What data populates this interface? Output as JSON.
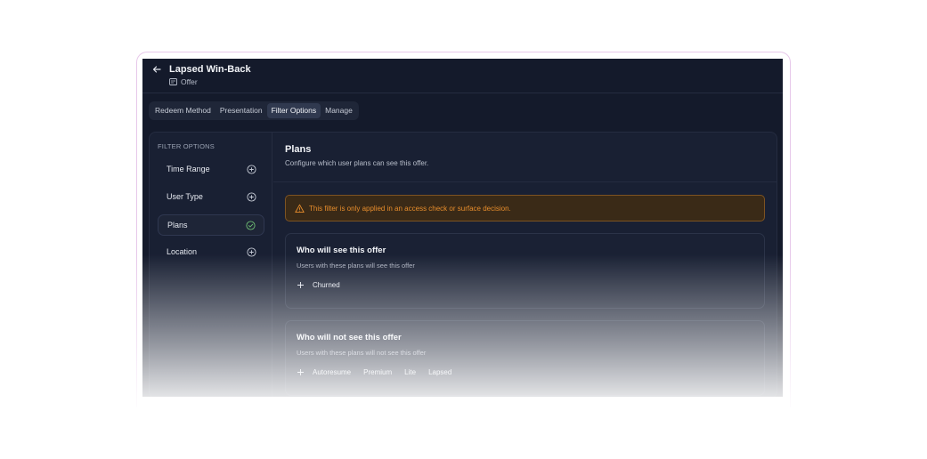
{
  "header": {
    "title": "Lapsed Win-Back",
    "subtitle": "Offer",
    "back_icon": "arrow-left-icon",
    "subtitle_icon": "ticket-icon"
  },
  "tabs": [
    {
      "label": "Redeem Method"
    },
    {
      "label": "Presentation"
    },
    {
      "label": "Filter Options",
      "active": true
    },
    {
      "label": "Manage"
    }
  ],
  "sidebar": {
    "heading": "FILTER OPTIONS",
    "items": [
      {
        "label": "Time Range",
        "icon": "plus-circle-icon"
      },
      {
        "label": "User Type",
        "icon": "plus-circle-icon"
      },
      {
        "label": "Plans",
        "icon": "check-circle-icon",
        "active": true
      },
      {
        "label": "Location",
        "icon": "plus-circle-icon"
      }
    ]
  },
  "content": {
    "title": "Plans",
    "description": "Configure which user plans can see this offer.",
    "warning": "This filter is only applied in an access check or surface decision.",
    "see_card": {
      "title": "Who will see this offer",
      "description": "Users with these plans will see this offer",
      "plans": [
        "Churned"
      ]
    },
    "not_see_card": {
      "title": "Who will not see this offer",
      "description": "Users with these plans will not see this offer",
      "plans": [
        "Autoresume",
        "Premium",
        "Lite",
        "Lapsed"
      ]
    }
  },
  "colors": {
    "background": "#141a2b",
    "warning_text": "#e78d2c",
    "check": "#6fbf73",
    "frame_border": "#e7c8ea"
  }
}
